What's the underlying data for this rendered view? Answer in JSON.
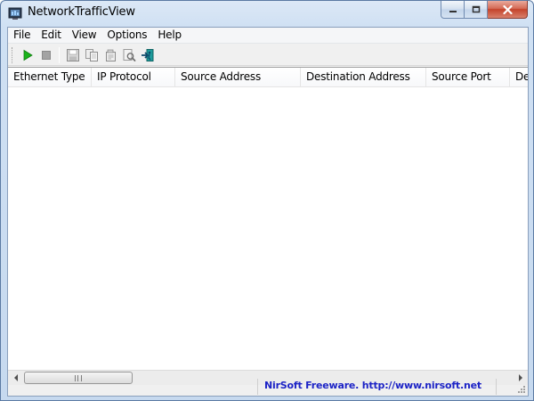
{
  "window": {
    "title": "NetworkTrafficView",
    "icon": "network-app-icon"
  },
  "menu": {
    "items": [
      {
        "label": "File"
      },
      {
        "label": "Edit"
      },
      {
        "label": "View"
      },
      {
        "label": "Options"
      },
      {
        "label": "Help"
      }
    ]
  },
  "toolbar": {
    "buttons": [
      {
        "icon": "play-icon",
        "color": "#19b319"
      },
      {
        "icon": "stop-icon",
        "color": "#9b9b9b"
      },
      {
        "icon": "save-icon"
      },
      {
        "icon": "copy-icon"
      },
      {
        "icon": "properties-icon"
      },
      {
        "icon": "find-icon"
      },
      {
        "icon": "exit-icon",
        "color": "#1a8c8c"
      }
    ]
  },
  "table": {
    "columns": [
      {
        "label": "Ethernet Type"
      },
      {
        "label": "IP Protocol"
      },
      {
        "label": "Source Address"
      },
      {
        "label": "Destination Address"
      },
      {
        "label": "Source Port"
      },
      {
        "label": "De"
      }
    ],
    "rows": []
  },
  "status": {
    "link_text": "NirSoft Freeware.  http://www.nirsoft.net",
    "link_color": "#1c23c6"
  }
}
